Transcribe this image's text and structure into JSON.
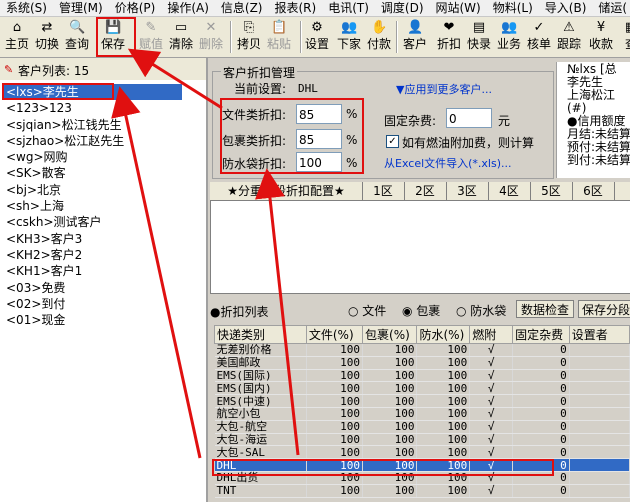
{
  "menu": [
    "系统(S)",
    "管理(M)",
    "价格(P)",
    "操作(A)",
    "信息(Z)",
    "报表(R)",
    "电讯(T)",
    "调度(D)",
    "网站(W)",
    "物料(L)",
    "导入(B)",
    "储运("
  ],
  "toolbar": [
    {
      "label": "主页",
      "icon": "home-icon",
      "glyph": "⌂",
      "disabled": false
    },
    {
      "label": "切换",
      "icon": "switch-icon",
      "glyph": "⇄",
      "disabled": false
    },
    {
      "label": "查询",
      "icon": "search-icon",
      "glyph": "🔍",
      "disabled": false
    },
    {
      "label": "保存",
      "icon": "save-icon",
      "glyph": "💾",
      "disabled": false
    },
    {
      "label": "赋值",
      "icon": "assign-icon",
      "glyph": "✎",
      "disabled": true
    },
    {
      "label": "清除",
      "icon": "clear-icon",
      "glyph": "▭",
      "disabled": false
    },
    {
      "label": "删除",
      "icon": "delete-icon",
      "glyph": "✕",
      "disabled": true
    },
    {
      "label": "拷贝",
      "icon": "copy-icon",
      "glyph": "⎘",
      "disabled": false
    },
    {
      "label": "粘贴",
      "icon": "paste-icon",
      "glyph": "📋",
      "disabled": true
    },
    {
      "label": "设置",
      "icon": "settings-icon",
      "glyph": "⚙",
      "disabled": false
    },
    {
      "label": "下家",
      "icon": "next-client-icon",
      "glyph": "👥",
      "disabled": false
    },
    {
      "label": "付款",
      "icon": "payment-icon",
      "glyph": "✋",
      "disabled": false
    },
    {
      "label": "客户",
      "icon": "customer-icon",
      "glyph": "👤",
      "disabled": false
    },
    {
      "label": "折扣",
      "icon": "discount-icon",
      "glyph": "❤",
      "disabled": false
    },
    {
      "label": "快录",
      "icon": "quick-entry-icon",
      "glyph": "▤",
      "disabled": false
    },
    {
      "label": "业务",
      "icon": "business-icon",
      "glyph": "👥",
      "disabled": false
    },
    {
      "label": "核单",
      "icon": "check-order-icon",
      "glyph": "✓",
      "disabled": false
    },
    {
      "label": "跟踪",
      "icon": "track-icon",
      "glyph": "⚠",
      "disabled": false
    },
    {
      "label": "收款",
      "icon": "collect-icon",
      "glyph": "¥",
      "disabled": false
    },
    {
      "label": "查",
      "icon": "query-icon",
      "glyph": "▦",
      "disabled": false
    }
  ],
  "customers": {
    "title": "客户列表: 15",
    "items": [
      "<lxs>李先生",
      "<123>123",
      "<sjqian>松江钱先生",
      "<sjzhao>松江赵先生",
      "<wg>网购",
      "<SK>散客",
      "<bj>北京",
      "<sh>上海",
      "<cskh>测试客户",
      "<KH3>客户3",
      "<KH2>客户2",
      "<KH1>客户1",
      "<03>免费",
      "<02>到付",
      "<01>现金"
    ],
    "selected": 0
  },
  "discount": {
    "group_title": "客户折扣管理",
    "current_label": "当前设置:",
    "current_value": "DHL",
    "apply_more": "▼应用到更多客户...",
    "file_label": "文件类折扣:",
    "file_value": "85",
    "pkg_label": "包裹类折扣:",
    "pkg_value": "85",
    "bag_label": "防水袋折扣:",
    "bag_value": "100",
    "pct": "%",
    "fixed_label": "固定杂费:",
    "fixed_value": "0",
    "fixed_unit": "元",
    "fuel_label": "如有燃油附加费，则计算",
    "import_link": "从Excel文件导入(*.xls)..."
  },
  "info_panel": {
    "title": "№lxs [总",
    "lines": [
      "李先生",
      "上海松江",
      "(#)",
      "●信用额度",
      "月结:未结算",
      "预付:未结算",
      "到付:未结算"
    ]
  },
  "zones": {
    "header": "★分重量段折扣配置★",
    "tabs": [
      "1区",
      "2区",
      "3区",
      "4区",
      "5区",
      "6区"
    ]
  },
  "list": {
    "title": "●折扣列表",
    "radio_file": "文件",
    "radio_pkg": "包裹",
    "radio_bag": "防水袋",
    "btn_check": "数据检查",
    "btn_save": "保存分段",
    "columns": [
      "快递类别",
      "文件(%)",
      "包裹(%)",
      "防水(%)",
      "燃附",
      "固定杂费",
      "设置者"
    ],
    "rows": [
      [
        "无差别价格",
        "100",
        "100",
        "100",
        "√",
        "0",
        ""
      ],
      [
        "美国邮政",
        "100",
        "100",
        "100",
        "√",
        "0",
        ""
      ],
      [
        "EMS(国际)",
        "100",
        "100",
        "100",
        "√",
        "0",
        ""
      ],
      [
        "EMS(国内)",
        "100",
        "100",
        "100",
        "√",
        "0",
        ""
      ],
      [
        "EMS(中速)",
        "100",
        "100",
        "100",
        "√",
        "0",
        ""
      ],
      [
        "航空小包",
        "100",
        "100",
        "100",
        "√",
        "0",
        ""
      ],
      [
        "大包-航空",
        "100",
        "100",
        "100",
        "√",
        "0",
        ""
      ],
      [
        "大包-海运",
        "100",
        "100",
        "100",
        "√",
        "0",
        ""
      ],
      [
        "大包-SAL",
        "100",
        "100",
        "100",
        "√",
        "0",
        ""
      ],
      [
        "DHL",
        "100",
        "100",
        "100",
        "√",
        "0",
        ""
      ],
      [
        "DHL出货",
        "100",
        "100",
        "100",
        "√",
        "0",
        ""
      ],
      [
        "TNT",
        "100",
        "100",
        "100",
        "√",
        "0",
        ""
      ]
    ],
    "selected": 9
  },
  "colors": {
    "selection": "#316ac5",
    "annotation": "#e01010"
  }
}
